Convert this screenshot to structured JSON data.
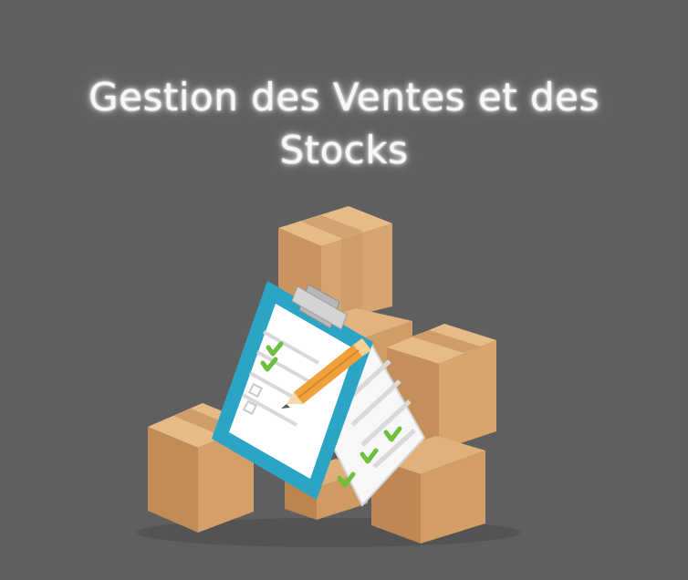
{
  "title": "Gestion des Ventes et des Stocks",
  "colors": {
    "background": "#5f5f5f",
    "box_main": "#d6a56f",
    "box_shadow": "#b98752",
    "clipboard_frame": "#2fa7c7",
    "paper": "#ffffff",
    "check_green": "#6fbf3f",
    "pencil_orange": "#f0a13b"
  },
  "icons": {
    "illustration": "boxes-and-inventory-clipboard-illustration",
    "boxes": "cardboard-box-icon",
    "clipboard": "clipboard-checklist-icon",
    "pencil": "pencil-icon",
    "check": "check-mark-icon"
  }
}
